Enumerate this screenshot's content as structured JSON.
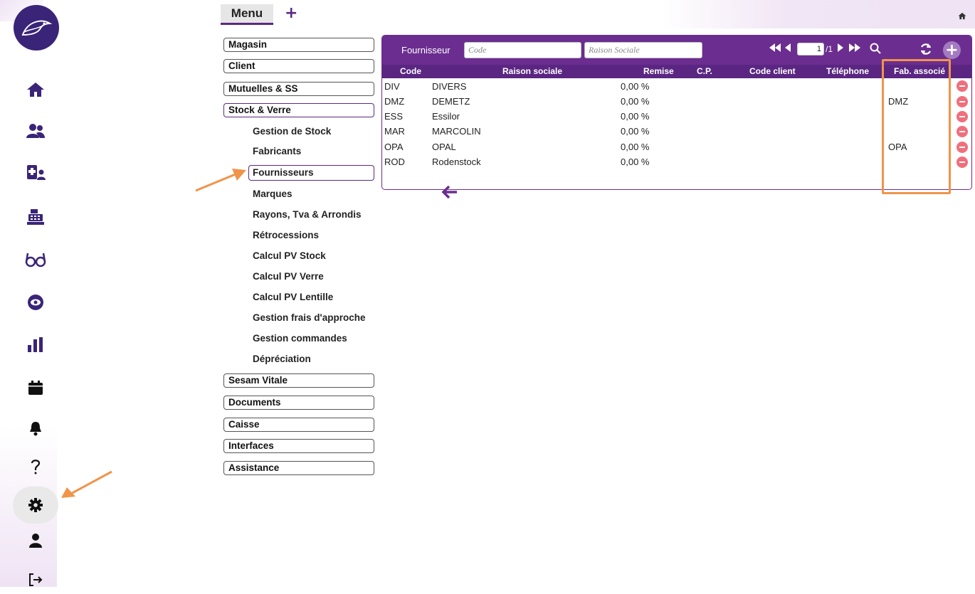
{
  "sidebar": {
    "icons": [
      {
        "name": "home-icon"
      },
      {
        "name": "users-icon"
      },
      {
        "name": "medical-user-icon"
      },
      {
        "name": "cash-register-icon"
      },
      {
        "name": "glasses-icon"
      },
      {
        "name": "eye-icon"
      },
      {
        "name": "bar-chart-icon"
      },
      {
        "name": "calendar-icon"
      },
      {
        "name": "bell-icon"
      },
      {
        "name": "help-icon"
      },
      {
        "name": "gear-icon",
        "active": true
      },
      {
        "name": "user-icon"
      },
      {
        "name": "logout-icon"
      }
    ],
    "active_bg": "#e9e9e9",
    "icon_color": "#3a2478"
  },
  "topbar": {
    "menu_tab_label": "Menu",
    "add_tab_label": "+"
  },
  "menu": {
    "sections": [
      {
        "label": "Magasin"
      },
      {
        "label": "Client"
      },
      {
        "label": "Mutuelles & SS"
      },
      {
        "label": "Stock & Verre",
        "open": true
      },
      {
        "label": "Sesam Vitale"
      },
      {
        "label": "Documents"
      },
      {
        "label": "Caisse"
      },
      {
        "label": "Interfaces"
      },
      {
        "label": "Assistance"
      }
    ],
    "stock_submenu": [
      "Gestion de Stock",
      "Fabricants",
      "Fournisseurs",
      "Marques",
      "Rayons, Tva & Arrondis",
      "Rétrocessions",
      "Calcul PV Stock",
      "Calcul PV Verre",
      "Calcul PV Lentille",
      "Gestion frais d'approche",
      "Gestion commandes",
      "Dépréciation"
    ],
    "selected_submenu": "Fournisseurs"
  },
  "panel": {
    "filter_label": "Fournisseur",
    "code_placeholder": "Code",
    "raison_placeholder": "Raison Sociale",
    "page_current": "1",
    "page_total": "/1",
    "columns": [
      "Code",
      "Raison sociale",
      "Remise",
      "C.P.",
      "Code client",
      "Téléphone",
      "Fab. associé"
    ],
    "rows": [
      {
        "code": "DIV",
        "raison": "DIVERS",
        "remise": "0,00 %",
        "cp": "",
        "code_client": "",
        "tel": "",
        "fab": ""
      },
      {
        "code": "DMZ",
        "raison": "DEMETZ",
        "remise": "0,00 %",
        "cp": "",
        "code_client": "",
        "tel": "",
        "fab": "DMZ"
      },
      {
        "code": "ESS",
        "raison": "Essilor",
        "remise": "0,00 %",
        "cp": "",
        "code_client": "",
        "tel": "",
        "fab": ""
      },
      {
        "code": "MAR",
        "raison": "MARCOLIN",
        "remise": "0,00 %",
        "cp": "",
        "code_client": "",
        "tel": "",
        "fab": ""
      },
      {
        "code": "OPA",
        "raison": "OPAL",
        "remise": "0,00 %",
        "cp": "",
        "code_client": "",
        "tel": "",
        "fab": "OPA"
      },
      {
        "code": "ROD",
        "raison": "Rodenstock",
        "remise": "0,00 %",
        "cp": "",
        "code_client": "",
        "tel": "",
        "fab": ""
      }
    ],
    "header_color": "#6b2d8f",
    "column_header_color": "#5a2682",
    "delete_color": "#f06f7c",
    "highlight_color": "#f0944a"
  }
}
